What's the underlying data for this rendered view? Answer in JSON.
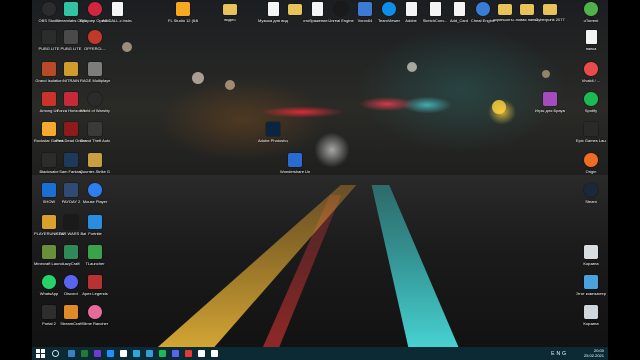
{
  "desktop": {
    "icons": [
      {
        "label": "OBS Studio",
        "color": "#2c2c2c",
        "shape": "round",
        "icon": "obs-icon"
      },
      {
        "label": "Streamlabs OBS",
        "color": "#31c3a2",
        "shape": "",
        "icon": "streamlabs-icon"
      },
      {
        "label": "Браузер Opera GX",
        "color": "#d2253f",
        "shape": "round",
        "icon": "opera-gx-icon"
      },
      {
        "label": "ASIDALL.c instruction...",
        "color": "#ffffff",
        "shape": "doc",
        "icon": "document-icon"
      },
      {
        "label": "FL Studio 12 (64bit)",
        "color": "#f7a821",
        "shape": "",
        "icon": "fl-studio-icon"
      },
      {
        "label": "видео",
        "color": "#e8c35a",
        "shape": "folder",
        "icon": "folder-icon"
      },
      {
        "label": "Музыка для видео",
        "color": "#ffffff",
        "shape": "doc",
        "icon": "document-icon"
      },
      {
        "label": "",
        "color": "#e8c35a",
        "shape": "folder",
        "icon": "folder-icon"
      },
      {
        "label": "отображение...",
        "color": "#ffffff",
        "shape": "doc",
        "icon": "document-icon"
      },
      {
        "label": "Unreal Engine",
        "color": "#1a1a1a",
        "shape": "round",
        "icon": "unreal-engine-icon"
      },
      {
        "label": "Vorox64",
        "color": "#3b7bd4",
        "shape": "",
        "icon": "vorox-icon"
      },
      {
        "label": "TeamViewer",
        "color": "#0e8ee9",
        "shape": "round",
        "icon": "teamviewer-icon"
      },
      {
        "label": "Adobe",
        "color": "#ffffff",
        "shape": "doc",
        "icon": "document-icon"
      },
      {
        "label": "SketchConv...",
        "color": "#ffffff",
        "shape": "doc",
        "icon": "document-icon"
      },
      {
        "label": "Add_Card",
        "color": "#ffffff",
        "shape": "doc",
        "icon": "document-icon"
      },
      {
        "label": "Cheat Engine",
        "color": "#3a7bd5",
        "shape": "round",
        "icon": "cheat-engine-icon"
      },
      {
        "label": "скриншоты...",
        "color": "#e8c35a",
        "shape": "folder",
        "icon": "folder-icon"
      },
      {
        "label": "новая папка",
        "color": "#e8c35a",
        "shape": "folder",
        "icon": "folder-icon"
      },
      {
        "label": "Cyberpunk 2077",
        "color": "#e8c35a",
        "shape": "folder",
        "icon": "folder-icon"
      },
      {
        "label": "uTorrent",
        "color": "#4fb34a",
        "shape": "round",
        "icon": "utorrent-icon"
      },
      {
        "label": "PUBG LITE",
        "color": "#2c2c2c",
        "shape": "",
        "icon": "pubg-icon"
      },
      {
        "label": "PUBG LITE",
        "color": "#4a4a4a",
        "shape": "",
        "icon": "pubg-icon"
      },
      {
        "label": "OFFERCL...",
        "color": "#c0392b",
        "shape": "round",
        "icon": "offer-icon"
      },
      {
        "label": "папка",
        "color": "#ffffff",
        "shape": "doc",
        "icon": "document-icon"
      },
      {
        "label": "Grand Isolation",
        "color": "#b84a2a",
        "shape": "",
        "icon": "game-icon"
      },
      {
        "label": "NITRAIN",
        "color": "#d09c2c",
        "shape": "",
        "icon": "game-icon"
      },
      {
        "label": "RAGE Multiplayer",
        "color": "#7d7d7d",
        "shape": "",
        "icon": "rage-mp-icon"
      },
      {
        "label": "Vivaldi / ...",
        "color": "#e94b4b",
        "shape": "round",
        "icon": "vivaldi-icon"
      },
      {
        "label": "Among Us",
        "color": "#c8342b",
        "shape": "",
        "icon": "among-us-icon"
      },
      {
        "label": "Forza Horizon 4",
        "color": "#c52a3b",
        "shape": "",
        "icon": "forza-icon"
      },
      {
        "label": "World of Warships",
        "color": "#2b2b2b",
        "shape": "round",
        "icon": "warships-icon"
      },
      {
        "label": "Игры для Браузера",
        "color": "#a44bbd",
        "shape": "",
        "icon": "winrar-icon"
      },
      {
        "label": "Spotify",
        "color": "#1db954",
        "shape": "round",
        "icon": "spotify-icon"
      },
      {
        "label": "Rockstar Games Launcher",
        "color": "#f6a92e",
        "shape": "",
        "icon": "rockstar-icon"
      },
      {
        "label": "Red Dead Online",
        "color": "#8e1b1b",
        "shape": "",
        "icon": "rdr-icon"
      },
      {
        "label": "Grand Theft Auto V",
        "color": "#3a3a3a",
        "shape": "",
        "icon": "gta-icon"
      },
      {
        "label": "Adobe Photoshop",
        "color": "#0b2540",
        "shape": "",
        "icon": "photoshop-icon"
      },
      {
        "label": "Epic Games Launcher",
        "color": "#2a2a2a",
        "shape": "",
        "icon": "epic-games-icon"
      },
      {
        "label": "Blackwake",
        "color": "#2c2c2c",
        "shape": "",
        "icon": "blackwake-icon"
      },
      {
        "label": "Sam Fantasy",
        "color": "#1e3a5a",
        "shape": "",
        "icon": "game-icon"
      },
      {
        "label": "Counter-Strike Global Off...",
        "color": "#c8a043",
        "shape": "",
        "icon": "csgo-icon"
      },
      {
        "label": "Origin",
        "color": "#f06b23",
        "shape": "round",
        "icon": "origin-icon"
      },
      {
        "label": "Wondershare UniConverter",
        "color": "#2a6bd1",
        "shape": "",
        "icon": "uniconverter-icon"
      },
      {
        "label": "Steam",
        "color": "#1b2838",
        "shape": "round",
        "icon": "steam-icon"
      },
      {
        "label": "SHOW",
        "color": "#1a6fd4",
        "shape": "",
        "icon": "show-icon"
      },
      {
        "label": "PAYDAY 2",
        "color": "#2f4a73",
        "shape": "",
        "icon": "payday-icon"
      },
      {
        "label": "Mouse Player",
        "color": "#2f7ef0",
        "shape": "round",
        "icon": "player-icon"
      },
      {
        "label": "PLAYERUNK BATTLEGR...",
        "color": "#d8a12c",
        "shape": "",
        "icon": "pubg-icon"
      },
      {
        "label": "STAR WARS Battlefront II",
        "color": "#1a1a1a",
        "shape": "",
        "icon": "star-wars-icon"
      },
      {
        "label": "Fortnite",
        "color": "#2a8ee0",
        "shape": "",
        "icon": "fortnite-icon"
      },
      {
        "label": "Minecraft Launcher",
        "color": "#6b8e3a",
        "shape": "",
        "icon": "minecraft-icon"
      },
      {
        "label": "LazyCraft",
        "color": "#2e8b57",
        "shape": "",
        "icon": "game-icon"
      },
      {
        "label": "TLauncher",
        "color": "#3aa34a",
        "shape": "",
        "icon": "tlauncher-icon"
      },
      {
        "label": "Корзина",
        "color": "#d8dde2",
        "shape": "",
        "icon": "recycle-bin-icon"
      },
      {
        "label": "WhatsApp",
        "color": "#25d366",
        "shape": "round",
        "icon": "whatsapp-icon"
      },
      {
        "label": "Discord",
        "color": "#5865f2",
        "shape": "round",
        "icon": "discord-icon"
      },
      {
        "label": "Apex Legends",
        "color": "#b93232",
        "shape": "",
        "icon": "apex-icon"
      },
      {
        "label": "Этот компьютер",
        "color": "#4aa3df",
        "shape": "",
        "icon": "this-pc-icon"
      },
      {
        "label": "Portal 2",
        "color": "#2e2e2e",
        "shape": "",
        "icon": "portal-icon"
      },
      {
        "label": "StreamCraft",
        "color": "#e08a2a",
        "shape": "",
        "icon": "streamcraft-icon"
      },
      {
        "label": "Slime Rancher",
        "color": "#e86a9a",
        "shape": "round",
        "icon": "slime-rancher-icon"
      },
      {
        "label": "Корзина",
        "color": "#cfd6dc",
        "shape": "",
        "icon": "recycle-bin-icon"
      }
    ]
  },
  "taskbar": {
    "time": "20:00",
    "date": "25.02.2021",
    "lang": "ENG",
    "apps": [
      {
        "color": "#3b82c4",
        "icon": "file-explorer-icon"
      },
      {
        "color": "#1f7a3a",
        "icon": "steam-icon"
      },
      {
        "color": "#6e3bd1",
        "icon": "visual-studio-icon"
      },
      {
        "color": "#1e90ff",
        "icon": "edge-icon"
      },
      {
        "color": "#ffffff",
        "icon": "store-icon"
      },
      {
        "color": "#2ba7e0",
        "icon": "mail-icon"
      },
      {
        "color": "#3a9ad9",
        "icon": "browser-icon"
      },
      {
        "color": "#1db954",
        "icon": "spotify-icon"
      },
      {
        "color": "#5865f2",
        "icon": "discord-icon"
      },
      {
        "color": "#e53935",
        "icon": "opera-gx-icon"
      },
      {
        "color": "#ffffff",
        "icon": "obs-icon"
      },
      {
        "color": "#ffffff",
        "icon": "settings-icon"
      }
    ]
  }
}
